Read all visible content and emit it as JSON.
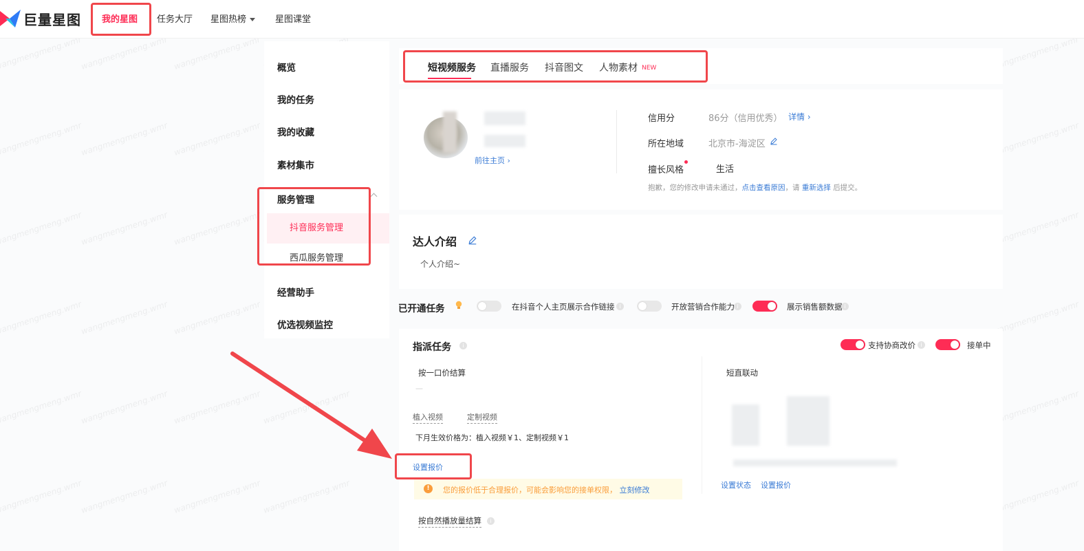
{
  "brand": {
    "name": "巨量星图"
  },
  "topnav": [
    {
      "label": "我的星图",
      "active": true
    },
    {
      "label": "任务大厅"
    },
    {
      "label": "星图热榜"
    },
    {
      "label": "星图课堂"
    }
  ],
  "sidebar": {
    "items": [
      {
        "label": "概览"
      },
      {
        "label": "我的任务"
      },
      {
        "label": "我的收藏"
      },
      {
        "label": "素材集市"
      },
      {
        "label": "服务管理"
      },
      {
        "label": "经营助手"
      },
      {
        "label": "优选视频监控"
      }
    ],
    "sub": [
      {
        "label": "抖音服务管理",
        "active": true
      },
      {
        "label": "西瓜服务管理"
      }
    ]
  },
  "tabs": [
    {
      "label": "短视频服务",
      "active": true
    },
    {
      "label": "直播服务"
    },
    {
      "label": "抖音图文"
    },
    {
      "label": "人物素材",
      "badge": "NEW"
    }
  ],
  "profile": {
    "homepage_link": "前往主页",
    "credit_label": "信用分",
    "credit_value": "86分（信用优秀）",
    "credit_detail": "详情",
    "region_label": "所在地域",
    "region_value": "北京市-海淀区",
    "style_label": "擅长风格",
    "style_value": "生活",
    "notice_prefix": "抱歉，您的修改申请未通过，",
    "notice_link1": "点击查看原因",
    "notice_mid": "，请",
    "notice_link2": "重新选择",
    "notice_suffix": "后提交。"
  },
  "intro": {
    "title": "达人介绍",
    "placeholder": "个人介绍~"
  },
  "opened": {
    "title": "已开通任务",
    "switches": [
      {
        "label": "在抖音个人主页展示合作链接",
        "on": false
      },
      {
        "label": "开放营销合作能力",
        "on": false
      },
      {
        "label": "展示销售额数据",
        "on": true
      }
    ]
  },
  "assign": {
    "title": "指派任务",
    "switch_negotiate": "支持协商改价",
    "switch_accept": "接单中",
    "one_price_title": "按一口价结算",
    "dash": "—",
    "col_embed": "植入视频",
    "col_custom": "定制视频",
    "next_month_price": "下月生效价格为：植入视频￥1、定制视频￥1",
    "set_price": "设置报价",
    "warning_text": "您的报价低于合理报价，可能会影响您的接单权限，",
    "warning_link": "立刻修改",
    "natural_title": "按自然播放量结算",
    "live_link_title": "短直联动",
    "live_set_status": "设置状态",
    "live_set_price": "设置报价"
  },
  "watermark": "wangmengmeng.wmr",
  "colors": {
    "accent": "#fe2c55",
    "link": "#3a7bd5",
    "annotation": "#f0464b",
    "warning": "#fa9d3b"
  }
}
